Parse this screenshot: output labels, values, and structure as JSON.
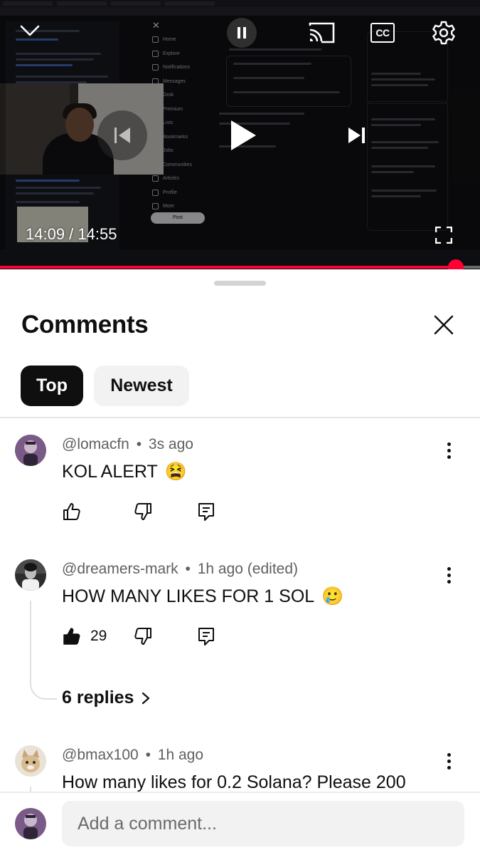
{
  "video": {
    "time_current": "14:09",
    "time_separator": " / ",
    "time_total": "14:55",
    "progress_fraction": 0.949,
    "cc_label": "CC",
    "background_nav": [
      "Home",
      "Explore",
      "Notifications",
      "Messages",
      "Grok",
      "Premium",
      "Lists",
      "Bookmarks",
      "Jobs",
      "Communities",
      "Articles",
      "Profile",
      "More"
    ],
    "background_post_label": "Post"
  },
  "sheet": {
    "title": "Comments",
    "tabs": [
      {
        "label": "Top",
        "selected": true
      },
      {
        "label": "Newest",
        "selected": false
      }
    ]
  },
  "comments": [
    {
      "author": "@lomacfn",
      "separator": "•",
      "time": "3s ago",
      "text": "KOL ALERT",
      "emoji": "😫",
      "avatar_color": "#7a5a87",
      "likes": "",
      "liked": false
    },
    {
      "author": "@dreamers-mark",
      "separator": "•",
      "time": "1h ago (edited)",
      "text": "HOW MANY LIKES FOR 1 SOL",
      "emoji": "🥲",
      "avatar_color": "#3a3a3a",
      "likes": "29",
      "liked": true,
      "replies_label": "6 replies"
    },
    {
      "author": "@bmax100",
      "separator": "•",
      "time": "1h ago",
      "text": "How many likes for 0.2 Solana? Please 200",
      "emoji": "",
      "avatar_color": "#e9e2d6"
    }
  ],
  "input": {
    "placeholder": "Add a comment..."
  },
  "colors": {
    "accent_red": "#ff0033",
    "chip_selected_bg": "#0f0f0f",
    "chip_bg": "#f2f2f2",
    "meta_text": "#606060"
  }
}
